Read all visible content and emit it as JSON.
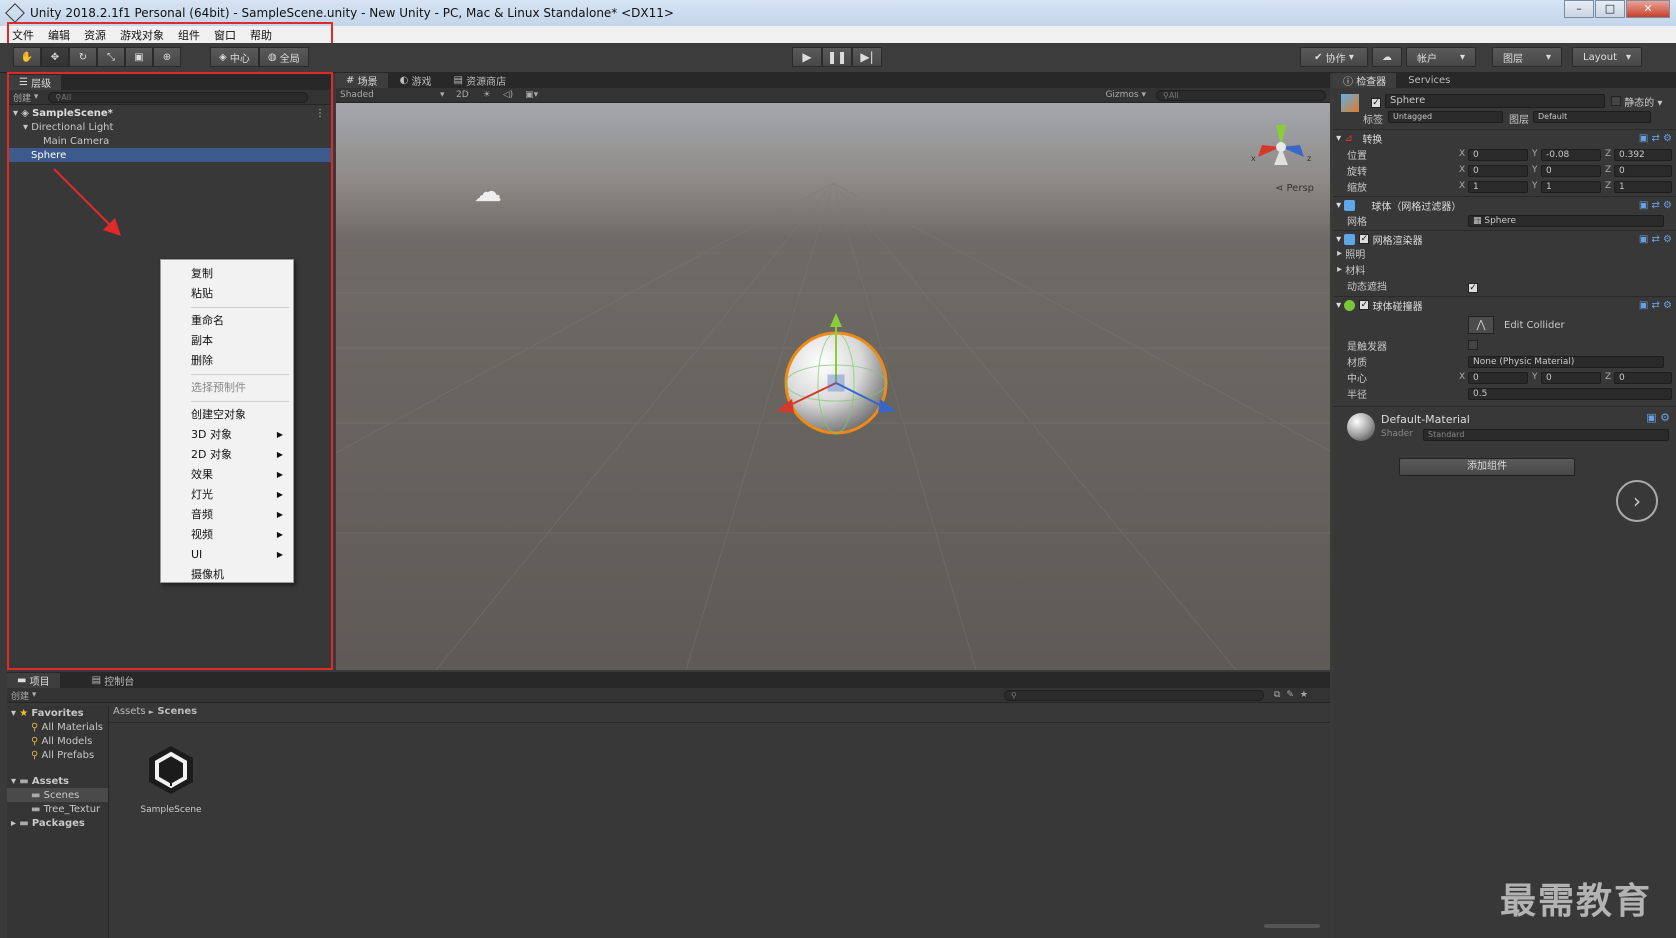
{
  "window": {
    "title": "Unity 2018.2.1f1 Personal (64bit) - SampleScene.unity - New Unity - PC, Mac & Linux Standalone* <DX11>",
    "min": "–",
    "max": "□",
    "close": "✕"
  },
  "menu": [
    "文件",
    "编辑",
    "资源",
    "游戏对象",
    "组件",
    "窗口",
    "帮助"
  ],
  "toolbar": {
    "pivot": "中心",
    "space": "全局",
    "collab": "协作",
    "account": "帐户",
    "layers": "图层",
    "layout": "Layout"
  },
  "hierarchy": {
    "tab": "层级",
    "create": "创建",
    "search_placeholder": "All",
    "scene": "SampleScene*",
    "items": [
      "Directional Light",
      "Main Camera",
      "Sphere"
    ]
  },
  "context_menu": {
    "items": [
      "复制",
      "粘贴",
      "重命名",
      "副本",
      "删除",
      "选择预制件",
      "创建空对象",
      "3D 对象",
      "2D 对象",
      "效果",
      "灯光",
      "音频",
      "视频",
      "UI",
      "摄像机"
    ]
  },
  "scene": {
    "tabs": [
      "场景",
      "游戏",
      "资源商店"
    ],
    "shading": "Shaded",
    "mode_2d": "2D",
    "gizmos": "Gizmos",
    "search_placeholder": "All",
    "persp": "Persp",
    "axes": {
      "x": "x",
      "z": "z"
    }
  },
  "inspector": {
    "tabs": [
      "检查器",
      "Services"
    ],
    "object_name": "Sphere",
    "static_label": "静态的",
    "tag_label": "标签",
    "tag_value": "Untagged",
    "layer_label": "图层",
    "layer_value": "Default",
    "transform": {
      "title": "转换",
      "rows": [
        {
          "label": "位置",
          "x": "0",
          "y": "-0.08",
          "z": "0.392"
        },
        {
          "label": "旋转",
          "x": "0",
          "y": "0",
          "z": "0"
        },
        {
          "label": "缩放",
          "x": "1",
          "y": "1",
          "z": "1"
        }
      ]
    },
    "mesh_filter": {
      "title": "球体（网格过滤器）",
      "mesh_label": "网格",
      "mesh_value": "Sphere"
    },
    "mesh_renderer": {
      "title": "网格渲染器",
      "lighting": "照明",
      "materials": "材料",
      "dynamic_occluded": "动态遮挡"
    },
    "sphere_collider": {
      "title": "球体碰撞器",
      "edit_collider": "Edit Collider",
      "is_trigger": "是触发器",
      "material_label": "材质",
      "material_value": "None (Physic Material)",
      "center_label": "中心",
      "center": {
        "x": "0",
        "y": "0",
        "z": "0"
      },
      "radius_label": "半径",
      "radius": "0.5"
    },
    "material": {
      "name": "Default-Material",
      "shader_label": "Shader",
      "shader_value": "Standard"
    },
    "add_component": "添加组件",
    "axis_labels": {
      "x": "X",
      "y": "Y",
      "z": "Z"
    }
  },
  "project": {
    "tabs": [
      "项目",
      "控制台"
    ],
    "create": "创建",
    "favorites": "Favorites",
    "fav_items": [
      "All Materials",
      "All Models",
      "All Prefabs"
    ],
    "assets": "Assets",
    "asset_items": [
      "Scenes",
      "Tree_Textur"
    ],
    "packages": "Packages",
    "breadcrumb": [
      "Assets",
      "Scenes"
    ],
    "breadcrumb_sep": "►",
    "file": "SampleScene"
  },
  "watermark": "最需教育",
  "colors": {
    "highlight": "#e02a2a",
    "selection": "#3c5a8c"
  }
}
